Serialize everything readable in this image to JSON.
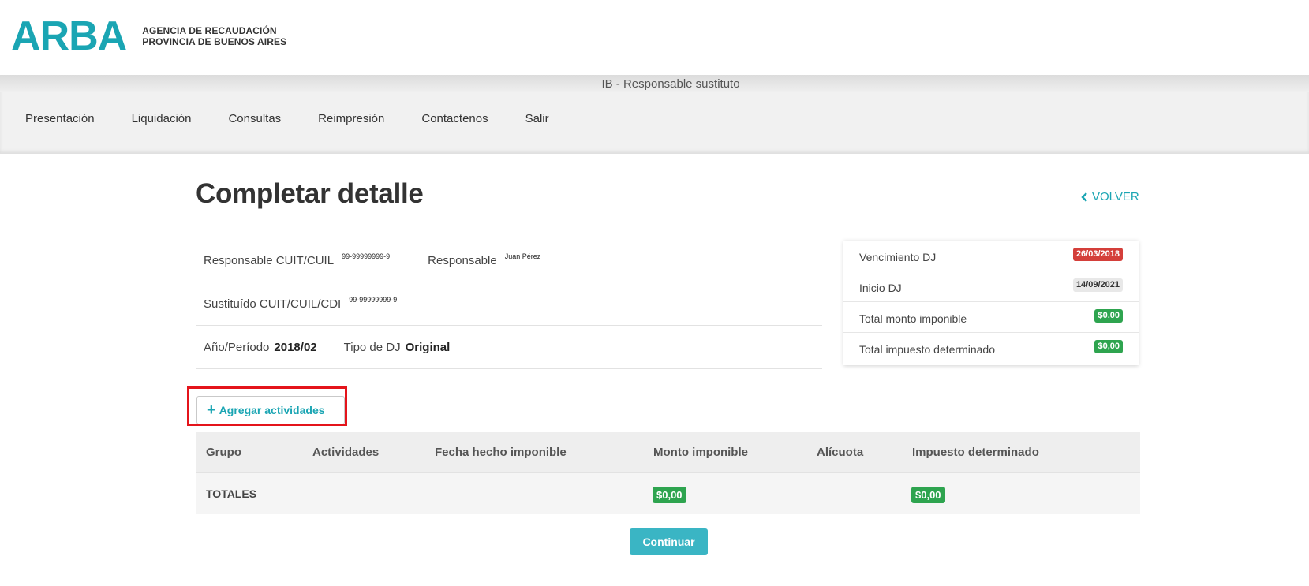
{
  "brand": {
    "logo": "ARBA",
    "line1": "AGENCIA DE RECAUDACIÓN",
    "line2": "PROVINCIA DE BUENOS AIRES"
  },
  "system_title": "IB - Responsable sustituto",
  "nav": [
    "Presentación",
    "Liquidación",
    "Consultas",
    "Reimpresión",
    "Contactenos",
    "Salir"
  ],
  "page": {
    "title": "Completar detalle",
    "back_label": "VOLVER",
    "back_icon": "chevron-left-icon"
  },
  "info": {
    "resp_cuit_label": "Responsable CUIT/CUIL",
    "resp_cuit_value": "99-99999999-9",
    "resp_label": "Responsable",
    "resp_value": "Juan Pérez",
    "sust_label": "Sustituído CUIT/CUIL/CDI",
    "sust_value": "99-99999999-9",
    "periodo_label": "Año/Período",
    "periodo_value": "2018/02",
    "tipo_label": "Tipo de DJ",
    "tipo_value": "Original"
  },
  "summary": [
    {
      "label": "Vencimiento DJ",
      "value": "26/03/2018",
      "color": "#d43f3a"
    },
    {
      "label": "Inicio DJ",
      "value": "14/09/2021",
      "color": "#e8e8e8"
    },
    {
      "label": "Total monto imponible",
      "value": "$0,00",
      "color": "#2ea44f"
    },
    {
      "label": "Total impuesto determinado",
      "value": "$0,00",
      "color": "#2ea44f"
    }
  ],
  "add_button": {
    "icon": "plus-icon",
    "label": "Agregar actividades"
  },
  "table": {
    "headers": [
      "Grupo",
      "Actividades",
      "Fecha hecho imponible",
      "Monto imponible",
      "Alícuota",
      "Impuesto determinado"
    ],
    "totals_label": "TOTALES",
    "total_monto": "$0,00",
    "total_impuesto": "$0,00"
  },
  "continue_label": "Continuar",
  "colors": {
    "accent": "#1aa5b3",
    "highlight": "#e4141b",
    "success": "#2ea44f",
    "danger": "#d43f3a"
  }
}
